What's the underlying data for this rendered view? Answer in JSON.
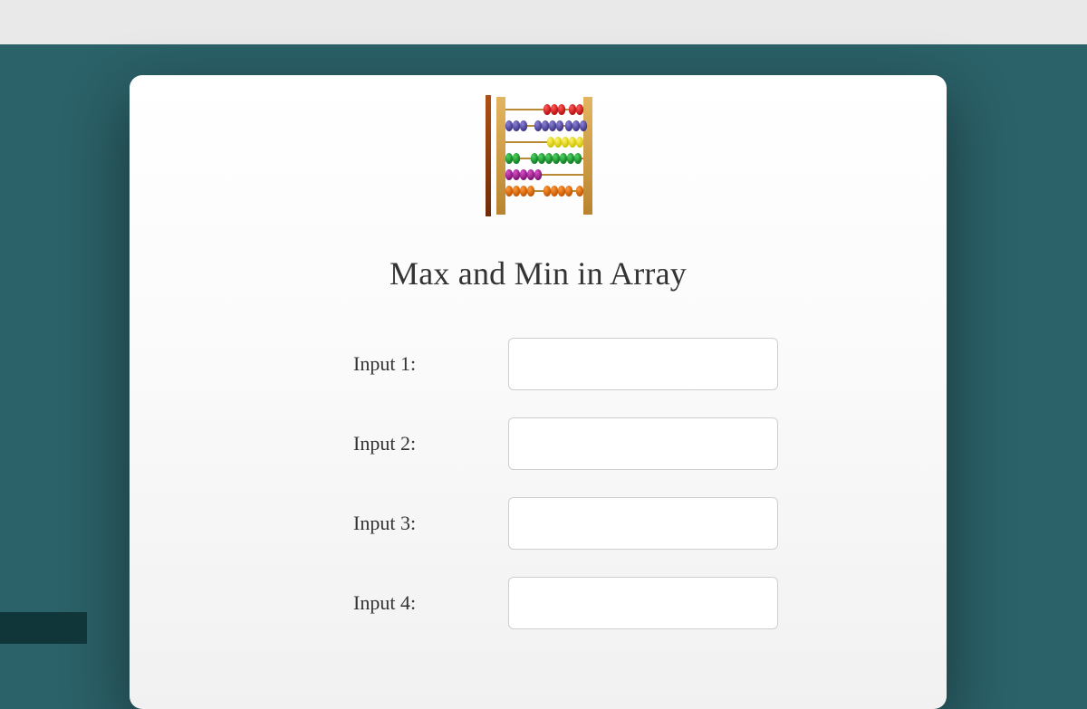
{
  "title": "Max and Min in Array",
  "inputs": [
    {
      "label": "Input 1:",
      "value": ""
    },
    {
      "label": "Input 2:",
      "value": ""
    },
    {
      "label": "Input 3:",
      "value": ""
    },
    {
      "label": "Input 4:",
      "value": ""
    }
  ],
  "icon": "abacus-icon",
  "colors": {
    "bead_rows": [
      "#d62728",
      "#5b4f9b",
      "#e6d100",
      "#1f9e3a",
      "#a8228e",
      "#e86b0d"
    ],
    "frame": "#d19a3a",
    "rod": "#b98936",
    "side_bar": "#8a3a0f"
  }
}
